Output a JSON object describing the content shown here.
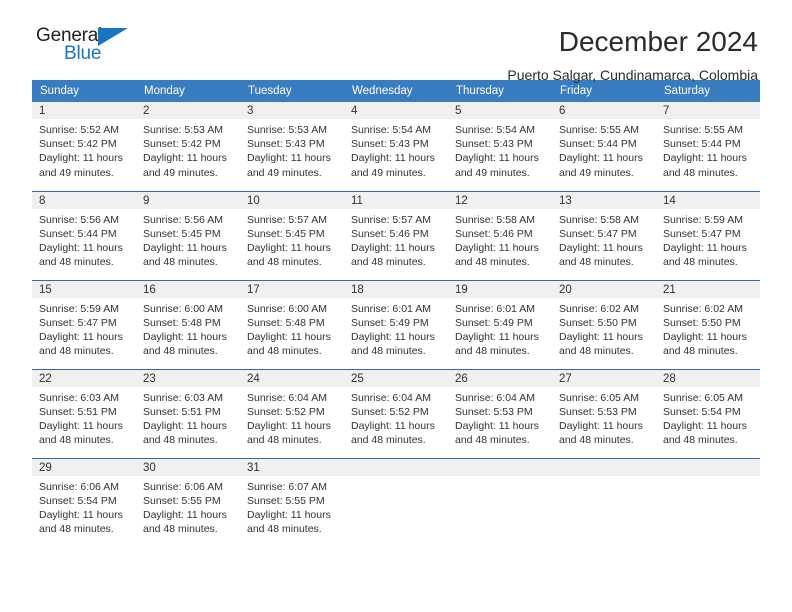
{
  "brand": {
    "name_part1": "General",
    "name_part2": "Blue",
    "color_dark": "#231f20",
    "color_blue": "#1b75bc"
  },
  "header": {
    "title": "December 2024",
    "subtitle": "Puerto Salgar, Cundinamarca, Colombia"
  },
  "theme": {
    "header_row_bg": "#3a7cc0",
    "row_divider": "#2d6ca8",
    "daynum_band_bg": "#f0f0f0",
    "text": "#333333"
  },
  "weekday_headers": [
    "Sunday",
    "Monday",
    "Tuesday",
    "Wednesday",
    "Thursday",
    "Friday",
    "Saturday"
  ],
  "weeks": [
    [
      {
        "day": "1",
        "sunrise": "Sunrise: 5:52 AM",
        "sunset": "Sunset: 5:42 PM",
        "daylight1": "Daylight: 11 hours",
        "daylight2": "and 49 minutes."
      },
      {
        "day": "2",
        "sunrise": "Sunrise: 5:53 AM",
        "sunset": "Sunset: 5:42 PM",
        "daylight1": "Daylight: 11 hours",
        "daylight2": "and 49 minutes."
      },
      {
        "day": "3",
        "sunrise": "Sunrise: 5:53 AM",
        "sunset": "Sunset: 5:43 PM",
        "daylight1": "Daylight: 11 hours",
        "daylight2": "and 49 minutes."
      },
      {
        "day": "4",
        "sunrise": "Sunrise: 5:54 AM",
        "sunset": "Sunset: 5:43 PM",
        "daylight1": "Daylight: 11 hours",
        "daylight2": "and 49 minutes."
      },
      {
        "day": "5",
        "sunrise": "Sunrise: 5:54 AM",
        "sunset": "Sunset: 5:43 PM",
        "daylight1": "Daylight: 11 hours",
        "daylight2": "and 49 minutes."
      },
      {
        "day": "6",
        "sunrise": "Sunrise: 5:55 AM",
        "sunset": "Sunset: 5:44 PM",
        "daylight1": "Daylight: 11 hours",
        "daylight2": "and 49 minutes."
      },
      {
        "day": "7",
        "sunrise": "Sunrise: 5:55 AM",
        "sunset": "Sunset: 5:44 PM",
        "daylight1": "Daylight: 11 hours",
        "daylight2": "and 48 minutes."
      }
    ],
    [
      {
        "day": "8",
        "sunrise": "Sunrise: 5:56 AM",
        "sunset": "Sunset: 5:44 PM",
        "daylight1": "Daylight: 11 hours",
        "daylight2": "and 48 minutes."
      },
      {
        "day": "9",
        "sunrise": "Sunrise: 5:56 AM",
        "sunset": "Sunset: 5:45 PM",
        "daylight1": "Daylight: 11 hours",
        "daylight2": "and 48 minutes."
      },
      {
        "day": "10",
        "sunrise": "Sunrise: 5:57 AM",
        "sunset": "Sunset: 5:45 PM",
        "daylight1": "Daylight: 11 hours",
        "daylight2": "and 48 minutes."
      },
      {
        "day": "11",
        "sunrise": "Sunrise: 5:57 AM",
        "sunset": "Sunset: 5:46 PM",
        "daylight1": "Daylight: 11 hours",
        "daylight2": "and 48 minutes."
      },
      {
        "day": "12",
        "sunrise": "Sunrise: 5:58 AM",
        "sunset": "Sunset: 5:46 PM",
        "daylight1": "Daylight: 11 hours",
        "daylight2": "and 48 minutes."
      },
      {
        "day": "13",
        "sunrise": "Sunrise: 5:58 AM",
        "sunset": "Sunset: 5:47 PM",
        "daylight1": "Daylight: 11 hours",
        "daylight2": "and 48 minutes."
      },
      {
        "day": "14",
        "sunrise": "Sunrise: 5:59 AM",
        "sunset": "Sunset: 5:47 PM",
        "daylight1": "Daylight: 11 hours",
        "daylight2": "and 48 minutes."
      }
    ],
    [
      {
        "day": "15",
        "sunrise": "Sunrise: 5:59 AM",
        "sunset": "Sunset: 5:47 PM",
        "daylight1": "Daylight: 11 hours",
        "daylight2": "and 48 minutes."
      },
      {
        "day": "16",
        "sunrise": "Sunrise: 6:00 AM",
        "sunset": "Sunset: 5:48 PM",
        "daylight1": "Daylight: 11 hours",
        "daylight2": "and 48 minutes."
      },
      {
        "day": "17",
        "sunrise": "Sunrise: 6:00 AM",
        "sunset": "Sunset: 5:48 PM",
        "daylight1": "Daylight: 11 hours",
        "daylight2": "and 48 minutes."
      },
      {
        "day": "18",
        "sunrise": "Sunrise: 6:01 AM",
        "sunset": "Sunset: 5:49 PM",
        "daylight1": "Daylight: 11 hours",
        "daylight2": "and 48 minutes."
      },
      {
        "day": "19",
        "sunrise": "Sunrise: 6:01 AM",
        "sunset": "Sunset: 5:49 PM",
        "daylight1": "Daylight: 11 hours",
        "daylight2": "and 48 minutes."
      },
      {
        "day": "20",
        "sunrise": "Sunrise: 6:02 AM",
        "sunset": "Sunset: 5:50 PM",
        "daylight1": "Daylight: 11 hours",
        "daylight2": "and 48 minutes."
      },
      {
        "day": "21",
        "sunrise": "Sunrise: 6:02 AM",
        "sunset": "Sunset: 5:50 PM",
        "daylight1": "Daylight: 11 hours",
        "daylight2": "and 48 minutes."
      }
    ],
    [
      {
        "day": "22",
        "sunrise": "Sunrise: 6:03 AM",
        "sunset": "Sunset: 5:51 PM",
        "daylight1": "Daylight: 11 hours",
        "daylight2": "and 48 minutes."
      },
      {
        "day": "23",
        "sunrise": "Sunrise: 6:03 AM",
        "sunset": "Sunset: 5:51 PM",
        "daylight1": "Daylight: 11 hours",
        "daylight2": "and 48 minutes."
      },
      {
        "day": "24",
        "sunrise": "Sunrise: 6:04 AM",
        "sunset": "Sunset: 5:52 PM",
        "daylight1": "Daylight: 11 hours",
        "daylight2": "and 48 minutes."
      },
      {
        "day": "25",
        "sunrise": "Sunrise: 6:04 AM",
        "sunset": "Sunset: 5:52 PM",
        "daylight1": "Daylight: 11 hours",
        "daylight2": "and 48 minutes."
      },
      {
        "day": "26",
        "sunrise": "Sunrise: 6:04 AM",
        "sunset": "Sunset: 5:53 PM",
        "daylight1": "Daylight: 11 hours",
        "daylight2": "and 48 minutes."
      },
      {
        "day": "27",
        "sunrise": "Sunrise: 6:05 AM",
        "sunset": "Sunset: 5:53 PM",
        "daylight1": "Daylight: 11 hours",
        "daylight2": "and 48 minutes."
      },
      {
        "day": "28",
        "sunrise": "Sunrise: 6:05 AM",
        "sunset": "Sunset: 5:54 PM",
        "daylight1": "Daylight: 11 hours",
        "daylight2": "and 48 minutes."
      }
    ],
    [
      {
        "day": "29",
        "sunrise": "Sunrise: 6:06 AM",
        "sunset": "Sunset: 5:54 PM",
        "daylight1": "Daylight: 11 hours",
        "daylight2": "and 48 minutes."
      },
      {
        "day": "30",
        "sunrise": "Sunrise: 6:06 AM",
        "sunset": "Sunset: 5:55 PM",
        "daylight1": "Daylight: 11 hours",
        "daylight2": "and 48 minutes."
      },
      {
        "day": "31",
        "sunrise": "Sunrise: 6:07 AM",
        "sunset": "Sunset: 5:55 PM",
        "daylight1": "Daylight: 11 hours",
        "daylight2": "and 48 minutes."
      },
      {
        "day": "",
        "sunrise": "",
        "sunset": "",
        "daylight1": "",
        "daylight2": ""
      },
      {
        "day": "",
        "sunrise": "",
        "sunset": "",
        "daylight1": "",
        "daylight2": ""
      },
      {
        "day": "",
        "sunrise": "",
        "sunset": "",
        "daylight1": "",
        "daylight2": ""
      },
      {
        "day": "",
        "sunrise": "",
        "sunset": "",
        "daylight1": "",
        "daylight2": ""
      }
    ]
  ]
}
